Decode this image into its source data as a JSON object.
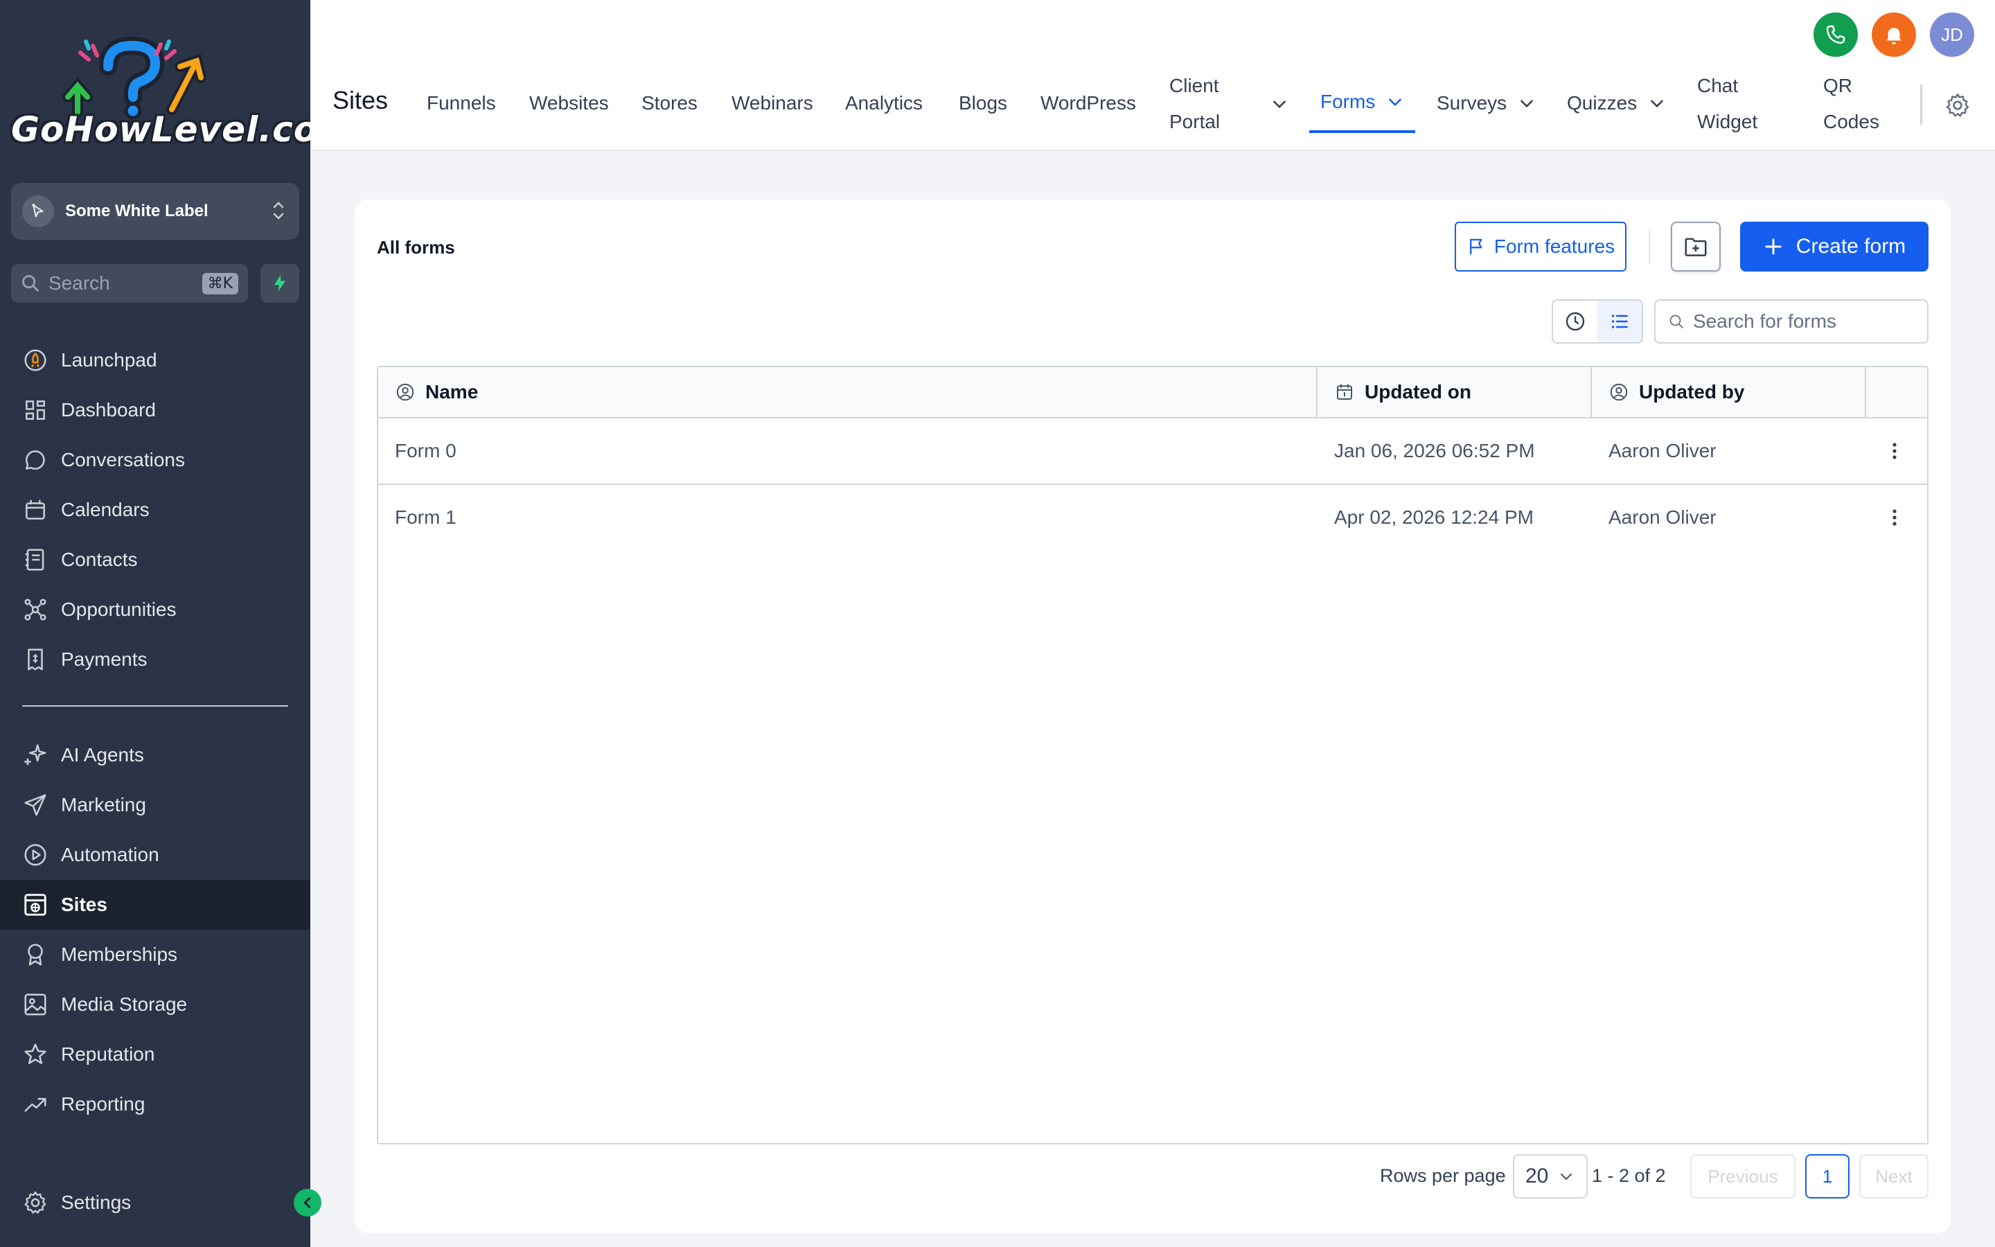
{
  "brand": {
    "logo_text": "GoHowLevel.com"
  },
  "sidebar": {
    "account": {
      "name": "Some White Label"
    },
    "search": {
      "placeholder": "Search",
      "shortcut": "⌘K"
    },
    "items": [
      {
        "label": "Launchpad",
        "icon": "rocket-icon"
      },
      {
        "label": "Dashboard",
        "icon": "grid-icon"
      },
      {
        "label": "Conversations",
        "icon": "chat-bubble-icon"
      },
      {
        "label": "Calendars",
        "icon": "calendar-icon"
      },
      {
        "label": "Contacts",
        "icon": "address-book-icon"
      },
      {
        "label": "Opportunities",
        "icon": "network-icon"
      },
      {
        "label": "Payments",
        "icon": "receipt-icon"
      },
      {
        "label": "AI Agents",
        "icon": "sparkle-icon"
      },
      {
        "label": "Marketing",
        "icon": "send-icon"
      },
      {
        "label": "Automation",
        "icon": "play-circle-icon"
      },
      {
        "label": "Sites",
        "icon": "browser-globe-icon",
        "active": true
      },
      {
        "label": "Memberships",
        "icon": "badge-icon"
      },
      {
        "label": "Media Storage",
        "icon": "image-icon"
      },
      {
        "label": "Reputation",
        "icon": "star-icon"
      },
      {
        "label": "Reporting",
        "icon": "trend-up-icon"
      }
    ],
    "settings_label": "Settings"
  },
  "topbar": {
    "title": "Sites",
    "tabs": [
      {
        "label": "Funnels"
      },
      {
        "label": "Websites"
      },
      {
        "label": "Stores"
      },
      {
        "label": "Webinars"
      },
      {
        "label": "Analytics"
      },
      {
        "label": "Blogs"
      },
      {
        "label": "WordPress"
      },
      {
        "label_line1": "Client",
        "label_line2": "Portal",
        "has_dropdown": true
      },
      {
        "label": "Forms",
        "has_dropdown": true,
        "active": true
      },
      {
        "label": "Surveys",
        "has_dropdown": true
      },
      {
        "label": "Quizzes",
        "has_dropdown": true
      },
      {
        "label_line1": "Chat",
        "label_line2": "Widget"
      },
      {
        "label_line1": "QR",
        "label_line2": "Codes"
      }
    ],
    "avatar_initials": "JD"
  },
  "forms": {
    "title": "All forms",
    "features_button": "Form features",
    "create_button": "Create form",
    "search_placeholder": "Search for forms",
    "columns": [
      "Name",
      "Updated on",
      "Updated by"
    ],
    "rows": [
      {
        "name": "Form 0",
        "updated_on": "Jan 06, 2026 06:52 PM",
        "updated_by": "Aaron Oliver"
      },
      {
        "name": "Form 1",
        "updated_on": "Apr 02, 2026 12:24 PM",
        "updated_by": "Aaron Oliver"
      }
    ]
  },
  "pagination": {
    "rows_per_page_label": "Rows per page",
    "rows_per_page": "20",
    "range": "1 - 2 of 2",
    "previous": "Previous",
    "current_page": "1",
    "next": "Next"
  },
  "colors": {
    "sidebar_bg": "#2b3446",
    "accent": "#155eef",
    "phone": "#0f9f4f",
    "bell": "#f26b1d",
    "avatar": "#7b8bd4"
  }
}
